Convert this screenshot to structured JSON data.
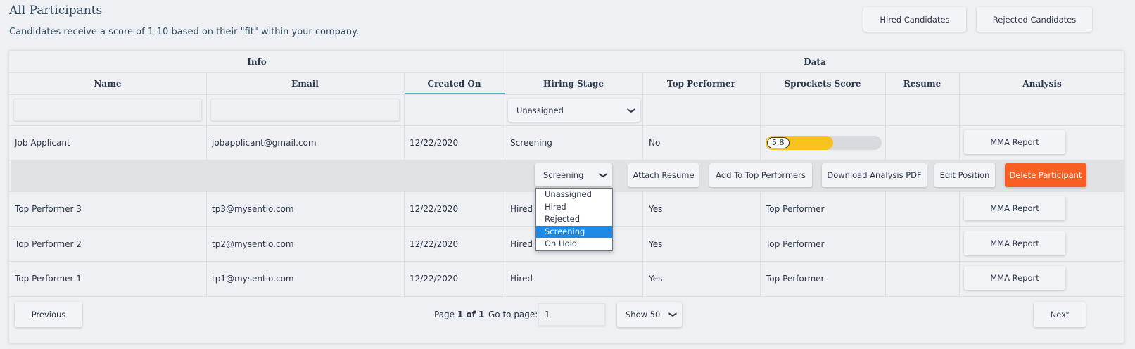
{
  "header": {
    "title": "All Participants",
    "subtitle": "Candidates receive a score of 1-10 based on their \"fit\" within your company.",
    "hired_label": "Hired Candidates",
    "rejected_label": "Rejected Candidates"
  },
  "table": {
    "groups": {
      "info": "Info",
      "data": "Data"
    },
    "columns": {
      "name": "Name",
      "email": "Email",
      "created_on": "Created On",
      "hiring_stage": "Hiring Stage",
      "top_performer": "Top Performer",
      "score": "Sprockets Score",
      "resume": "Resume",
      "analysis": "Analysis"
    },
    "filter_stage_value": "Unassigned",
    "rows": [
      {
        "name": "Job Applicant",
        "email": "jobapplicant@gmail.com",
        "created": "12/22/2020",
        "stage": "Screening",
        "top": "No",
        "score_label": "5.8",
        "score_fraction": 0.58,
        "analysis": "MMA Report"
      },
      {
        "name": "Top Performer 3",
        "email": "tp3@mysentio.com",
        "created": "12/22/2020",
        "stage": "Hired",
        "top": "Yes",
        "score_text": "Top Performer",
        "analysis": "MMA Report"
      },
      {
        "name": "Top Performer 2",
        "email": "tp2@mysentio.com",
        "created": "12/22/2020",
        "stage": "Hired",
        "top": "Yes",
        "score_text": "Top Performer",
        "analysis": "MMA Report"
      },
      {
        "name": "Top Performer 1",
        "email": "tp1@mysentio.com",
        "created": "12/22/2020",
        "stage": "Hired",
        "top": "Yes",
        "score_text": "Top Performer",
        "analysis": "MMA Report"
      }
    ]
  },
  "actions": {
    "stage_value": "Screening",
    "attach_resume": "Attach Resume",
    "add_top": "Add To Top Performers",
    "download_pdf": "Download Analysis PDF",
    "edit_position": "Edit Position",
    "delete": "Delete Participant",
    "stage_options": [
      "Unassigned",
      "Hired",
      "Rejected",
      "Screening",
      "On Hold"
    ],
    "selected_option": "Screening"
  },
  "pagination": {
    "previous": "Previous",
    "next": "Next",
    "page_prefix": "Page",
    "page_current": "1 of 1",
    "goto_label": "Go to page:",
    "goto_value": "1",
    "show_value": "Show 50"
  },
  "colors": {
    "accent": "#4fb3c8",
    "danger": "#f95f22",
    "score": "#f9c31e",
    "selected": "#1e88e5"
  }
}
